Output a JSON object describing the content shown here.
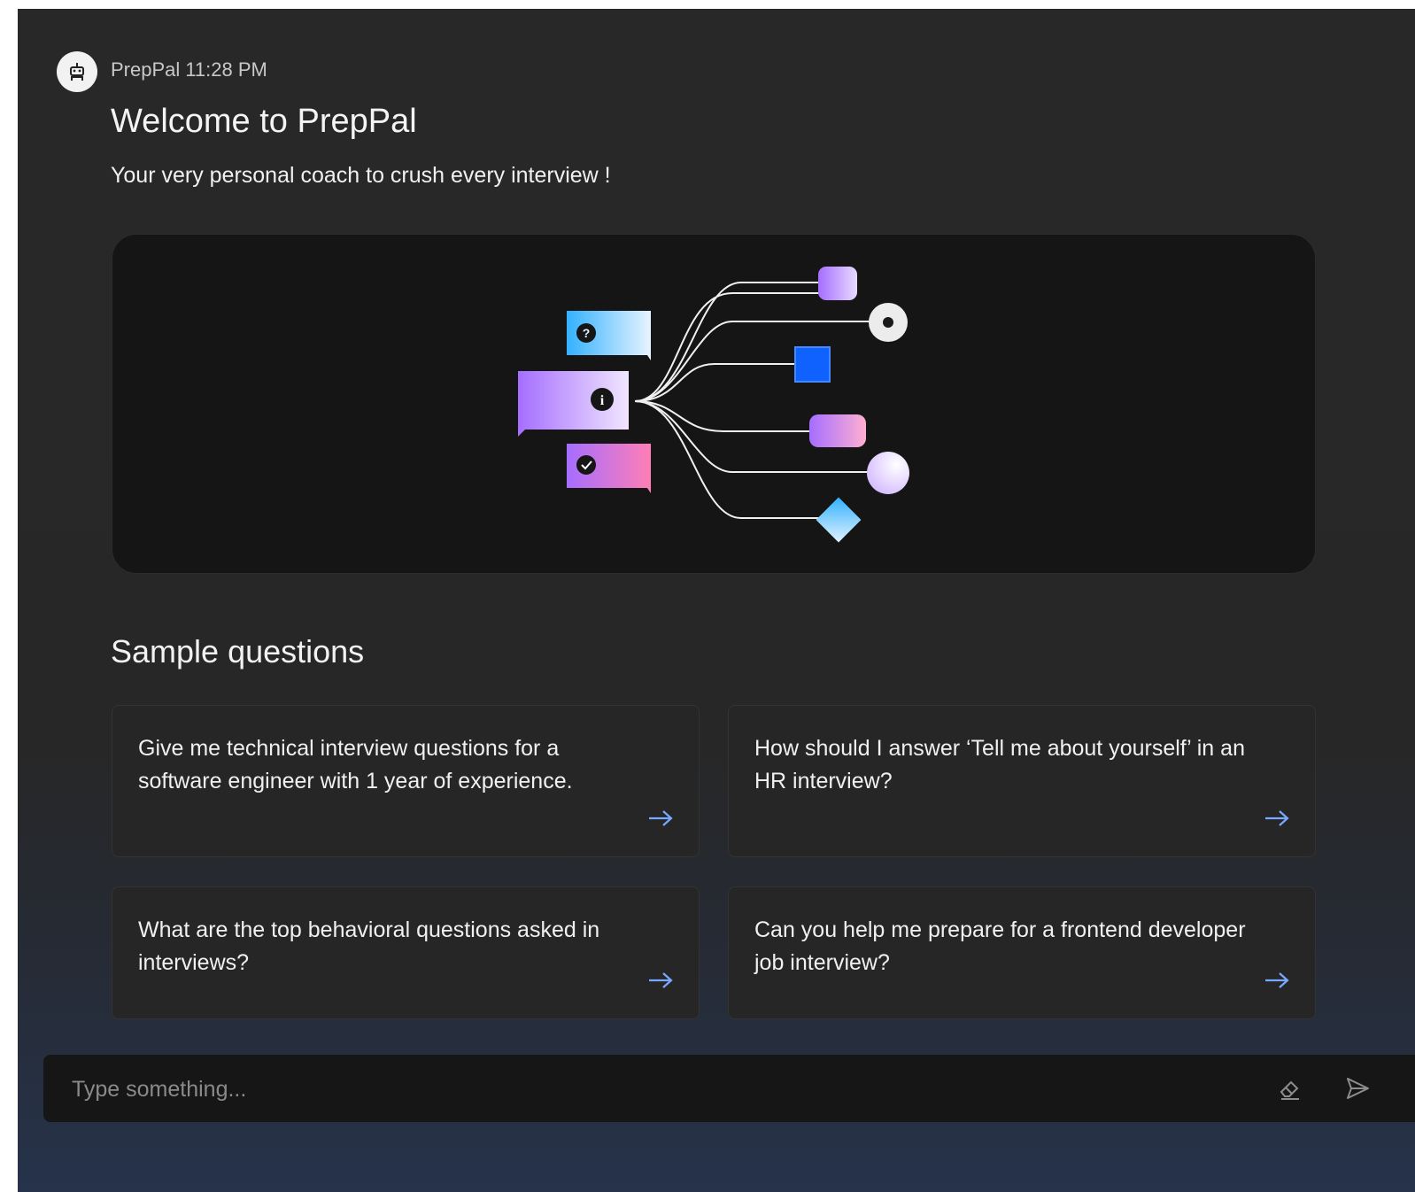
{
  "message": {
    "sender": "PrepPal",
    "time": "11:28 PM",
    "avatar_icon": "robot-icon",
    "title": "Welcome to PrepPal",
    "subtitle": "Your very personal coach to crush every interview !"
  },
  "sample_questions": {
    "heading": "Sample questions",
    "items": [
      {
        "text": "Give me technical interview questions for a software engineer with 1 year of experience.",
        "icon": "arrow-right-icon"
      },
      {
        "text": "How should I answer ‘Tell me about yourself’ in an HR interview?",
        "icon": "arrow-right-icon"
      },
      {
        "text": "What are the top behavioral questions asked in interviews?",
        "icon": "arrow-right-icon"
      },
      {
        "text": "Can you help me prepare for a frontend developer job interview?",
        "icon": "arrow-right-icon"
      }
    ]
  },
  "composer": {
    "placeholder": "Type something...",
    "clear_icon": "eraser-icon",
    "send_icon": "send-icon"
  },
  "colors": {
    "background": "#282828",
    "card": "#262626",
    "accent_arrow": "#78a9ff",
    "hero_bg": "#151515"
  }
}
